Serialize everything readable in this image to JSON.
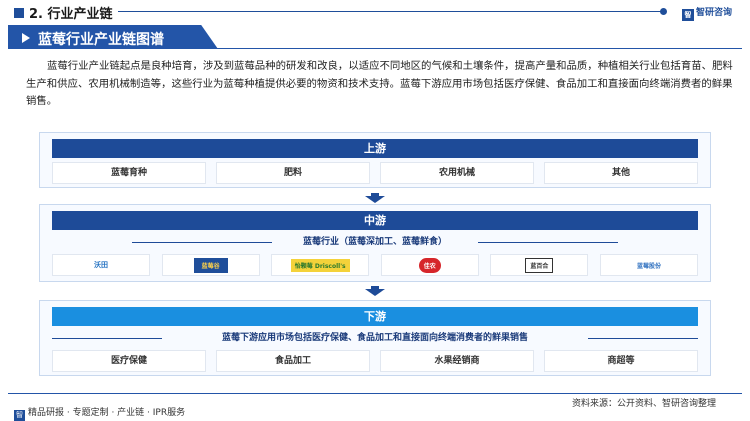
{
  "header": {
    "section_title": "2. 行业产业链",
    "brand_logo_text": "智",
    "brand_name": "智研咨询"
  },
  "banner": {
    "title": "蓝莓行业产业链图谱"
  },
  "intro": {
    "text": "蓝莓行业产业链起点是良种培育，涉及到蓝莓品种的研发和改良，以适应不同地区的气候和土壤条件，提高产量和品质，种植相关行业包括育苗、肥料生产和供应、农用机械制造等，这些行业为蓝莓种植提供必要的物资和技术支持。蓝莓下游应用市场包括医疗保健、食品加工和直接面向终端消费者的鲜果销售。"
  },
  "upstream": {
    "label": "上游",
    "items": [
      "蓝莓育种",
      "肥料",
      "农用机械",
      "其他"
    ]
  },
  "midstream": {
    "label": "中游",
    "subtitle": "蓝莓行业（蓝莓深加工、蓝莓鲜食）",
    "logos": [
      {
        "text": "沃田",
        "icon": "wotian-logo",
        "color": "#1f6fc0"
      },
      {
        "text": "蓝莓谷",
        "icon": "lanmeigu-logo",
        "color": "#1f4e9a"
      },
      {
        "text": "怡颗莓 Driscoll's",
        "icon": "driscolls-logo",
        "color": "#2d7a2d"
      },
      {
        "text": "佳农",
        "icon": "joyvio-logo",
        "color": "#d6262b"
      },
      {
        "text": "蓝百合",
        "icon": "lanbaihe-logo",
        "color": "#333333"
      },
      {
        "text": "蓝莓股份",
        "icon": "lanmei-gufen-logo",
        "color": "#2d6fbf"
      }
    ]
  },
  "downstream": {
    "label": "下游",
    "subtitle": "蓝莓下游应用市场包括医疗保健、食品加工和直接面向终端消费者的鲜果销售",
    "items": [
      "医疗保健",
      "食品加工",
      "水果经销商",
      "商超等"
    ]
  },
  "footer": {
    "left_icon": "智",
    "left_text": "精品研报 · 专题定制 · 产业链 · IPR服务",
    "source": "资料来源：公开资料、智研咨询整理"
  }
}
